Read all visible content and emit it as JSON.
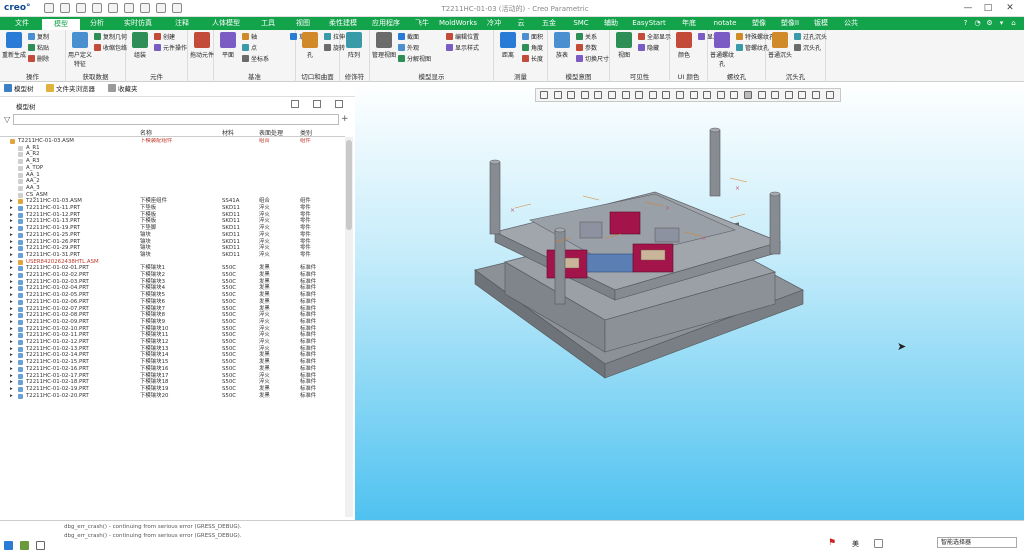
{
  "app": {
    "logo": "creo°",
    "title": "T2211HC-01-03 (活动的) - Creo Parametric"
  },
  "window_controls": [
    "—",
    "□",
    "✕"
  ],
  "tabs": [
    "文件",
    "模型",
    "分析",
    "实时仿真",
    "注释",
    "人体模型",
    "工具",
    "视图",
    "柔性建模",
    "应用程序",
    "飞牛",
    "MoldWorks",
    "冷冲",
    "云",
    "五金",
    "SMC",
    "辅助",
    "EasyStart",
    "年底",
    "notate",
    "塑像",
    "塑像II",
    "钣模",
    "公共"
  ],
  "active_tab": "模型",
  "ribbon": {
    "groups": [
      {
        "label": "操作",
        "items": [
          "重新生成",
          "复制",
          "粘贴",
          "删除"
        ]
      },
      {
        "label": "获取数据",
        "items": [
          "用户定义特征",
          "复制几何",
          "收缩包络"
        ]
      },
      {
        "label": "元件",
        "items": [
          "组装",
          "创建",
          "元件操作"
        ]
      },
      {
        "label": "",
        "items": [
          "拖动元件"
        ]
      },
      {
        "label": "基准",
        "items": [
          "平面",
          "轴",
          "点",
          "坐标系",
          "草绘"
        ]
      },
      {
        "label": "切口和曲面",
        "items": [
          "孔",
          "拉伸",
          "旋转"
        ]
      },
      {
        "label": "修饰符",
        "items": [
          "阵列"
        ]
      },
      {
        "label": "模型显示",
        "items": [
          "管理视图",
          "截面",
          "外观",
          "分解视图",
          "编辑位置",
          "显示样式"
        ]
      },
      {
        "label": "测量",
        "items": [
          "距离",
          "面积",
          "角度",
          "长度"
        ]
      },
      {
        "label": "模型意图",
        "items": [
          "族表",
          "关系",
          "参数",
          "切换尺寸"
        ]
      },
      {
        "label": "可见性",
        "items": [
          "视图",
          "全部显示",
          "隐藏"
        ]
      },
      {
        "label": "UI 颜色",
        "items": [
          "颜色",
          "显示"
        ]
      },
      {
        "label": "螺纹孔",
        "items": [
          "普通螺纹孔",
          "特殊螺纹孔",
          "管螺纹孔"
        ]
      },
      {
        "label": "沉头孔",
        "items": [
          "普通沉头",
          "过孔沉头",
          "沉头孔"
        ]
      }
    ]
  },
  "nav_tabs": [
    "模型树",
    "文件夹浏览器",
    "收藏夹"
  ],
  "model_tree": {
    "title": "模型树",
    "columns": [
      "名称",
      "材料",
      "表面处理",
      "类别"
    ],
    "root": "T2211HC-01-03.ASM",
    "rows": [
      {
        "name": "T2211HC-01-03.ASM",
        "n": "下模装配组件",
        "m": "",
        "s": "组合",
        "c": "组件"
      },
      {
        "name": "A_R1",
        "n": "",
        "m": "",
        "s": "",
        "c": ""
      },
      {
        "name": "A_R2",
        "n": "",
        "m": "",
        "s": "",
        "c": ""
      },
      {
        "name": "A_R3",
        "n": "",
        "m": "",
        "s": "",
        "c": ""
      },
      {
        "name": "A_TOP",
        "n": "",
        "m": "",
        "s": "",
        "c": ""
      },
      {
        "name": "AA_1",
        "n": "",
        "m": "",
        "s": "",
        "c": ""
      },
      {
        "name": "AA_2",
        "n": "",
        "m": "",
        "s": "",
        "c": ""
      },
      {
        "name": "AA_3",
        "n": "",
        "m": "",
        "s": "",
        "c": ""
      },
      {
        "name": "CS_ASM",
        "n": "",
        "m": "",
        "s": "",
        "c": ""
      },
      {
        "name": "T2211HC-01-03.ASM",
        "n": "下模座组件",
        "m": "SS41A",
        "s": "组合",
        "c": "组件"
      },
      {
        "name": "T2211HC-01-11.PRT",
        "n": "下垫板",
        "m": "SKD11",
        "s": "淬火",
        "c": "零件"
      },
      {
        "name": "T2211HC-01-12.PRT",
        "n": "下模板",
        "m": "SKD11",
        "s": "淬火",
        "c": "零件"
      },
      {
        "name": "T2211HC-01-13.PRT",
        "n": "下模板",
        "m": "SKD11",
        "s": "淬火",
        "c": "零件"
      },
      {
        "name": "T2211HC-01-19.PRT",
        "n": "下垫脚",
        "m": "SKD11",
        "s": "淬火",
        "c": "零件"
      },
      {
        "name": "T2211HC-01-25.PRT",
        "n": "镶块",
        "m": "SKD11",
        "s": "淬火",
        "c": "零件"
      },
      {
        "name": "T2211HC-01-26.PRT",
        "n": "镶块",
        "m": "SKD11",
        "s": "淬火",
        "c": "零件"
      },
      {
        "name": "T2211HC-01-29.PRT",
        "n": "镶块",
        "m": "SKD11",
        "s": "淬火",
        "c": "零件"
      },
      {
        "name": "T2211HC-01-31.PRT",
        "n": "镶块",
        "m": "SKD11",
        "s": "淬火",
        "c": "零件"
      },
      {
        "name": "USER8420262438HTL.ASM",
        "n": "",
        "m": "",
        "s": "",
        "c": ""
      },
      {
        "name": "T2211HC-01-02-01.PRT",
        "n": "下模镶块1",
        "m": "S50C",
        "s": "发黑",
        "c": "标准件"
      },
      {
        "name": "T2211HC-01-02-02.PRT",
        "n": "下模镶块2",
        "m": "S50C",
        "s": "发黑",
        "c": "标准件"
      },
      {
        "name": "T2211HC-01-02-03.PRT",
        "n": "下模镶块3",
        "m": "S50C",
        "s": "发黑",
        "c": "标准件"
      },
      {
        "name": "T2211HC-01-02-04.PRT",
        "n": "下模镶块4",
        "m": "S50C",
        "s": "发黑",
        "c": "标准件"
      },
      {
        "name": "T2211HC-01-02-05.PRT",
        "n": "下模镶块5",
        "m": "S50C",
        "s": "发黑",
        "c": "标准件"
      },
      {
        "name": "T2211HC-01-02-06.PRT",
        "n": "下模镶块6",
        "m": "S50C",
        "s": "发黑",
        "c": "标准件"
      },
      {
        "name": "T2211HC-01-02-07.PRT",
        "n": "下模镶块7",
        "m": "S50C",
        "s": "发黑",
        "c": "标准件"
      },
      {
        "name": "T2211HC-01-02-08.PRT",
        "n": "下模镶块8",
        "m": "S50C",
        "s": "淬火",
        "c": "标准件"
      },
      {
        "name": "T2211HC-01-02-09.PRT",
        "n": "下模镶块9",
        "m": "S50C",
        "s": "淬火",
        "c": "标准件"
      },
      {
        "name": "T2211HC-01-02-10.PRT",
        "n": "下模镶块10",
        "m": "S50C",
        "s": "淬火",
        "c": "标准件"
      },
      {
        "name": "T2211HC-01-02-11.PRT",
        "n": "下模镶块11",
        "m": "S50C",
        "s": "淬火",
        "c": "标准件"
      },
      {
        "name": "T2211HC-01-02-12.PRT",
        "n": "下模镶块12",
        "m": "S50C",
        "s": "淬火",
        "c": "标准件"
      },
      {
        "name": "T2211HC-01-02-13.PRT",
        "n": "下模镶块13",
        "m": "S50C",
        "s": "淬火",
        "c": "标准件"
      },
      {
        "name": "T2211HC-01-02-14.PRT",
        "n": "下模镶块14",
        "m": "S50C",
        "s": "发黑",
        "c": "标准件"
      },
      {
        "name": "T2211HC-01-02-15.PRT",
        "n": "下模镶块15",
        "m": "S50C",
        "s": "发黑",
        "c": "标准件"
      },
      {
        "name": "T2211HC-01-02-16.PRT",
        "n": "下模镶块16",
        "m": "S50C",
        "s": "发黑",
        "c": "标准件"
      },
      {
        "name": "T2211HC-01-02-17.PRT",
        "n": "下模镶块17",
        "m": "S50C",
        "s": "淬火",
        "c": "标准件"
      },
      {
        "name": "T2211HC-01-02-18.PRT",
        "n": "下模镶块18",
        "m": "S50C",
        "s": "淬火",
        "c": "标准件"
      },
      {
        "name": "T2211HC-01-02-19.PRT",
        "n": "下模镶块19",
        "m": "S50C",
        "s": "发黑",
        "c": "标准件"
      },
      {
        "name": "T2211HC-01-02-20.PRT",
        "n": "下模镶块20",
        "m": "S50C",
        "s": "发黑",
        "c": "标准件"
      }
    ]
  },
  "messages": [
    "dbg_err_crash() - continuing from serious error (GRESS_DEBUG).",
    "dbg_err_crash() - continuing from serious error (GRESS_DEBUG)."
  ],
  "status": {
    "unit": "美",
    "filter": "智能选择器"
  },
  "colors": {
    "accent": "#13a34b",
    "viewport_top": "#ffffff",
    "viewport_bottom": "#4fc2f0",
    "model_gray": "#8a8f96",
    "insert_red": "#a3154a"
  }
}
